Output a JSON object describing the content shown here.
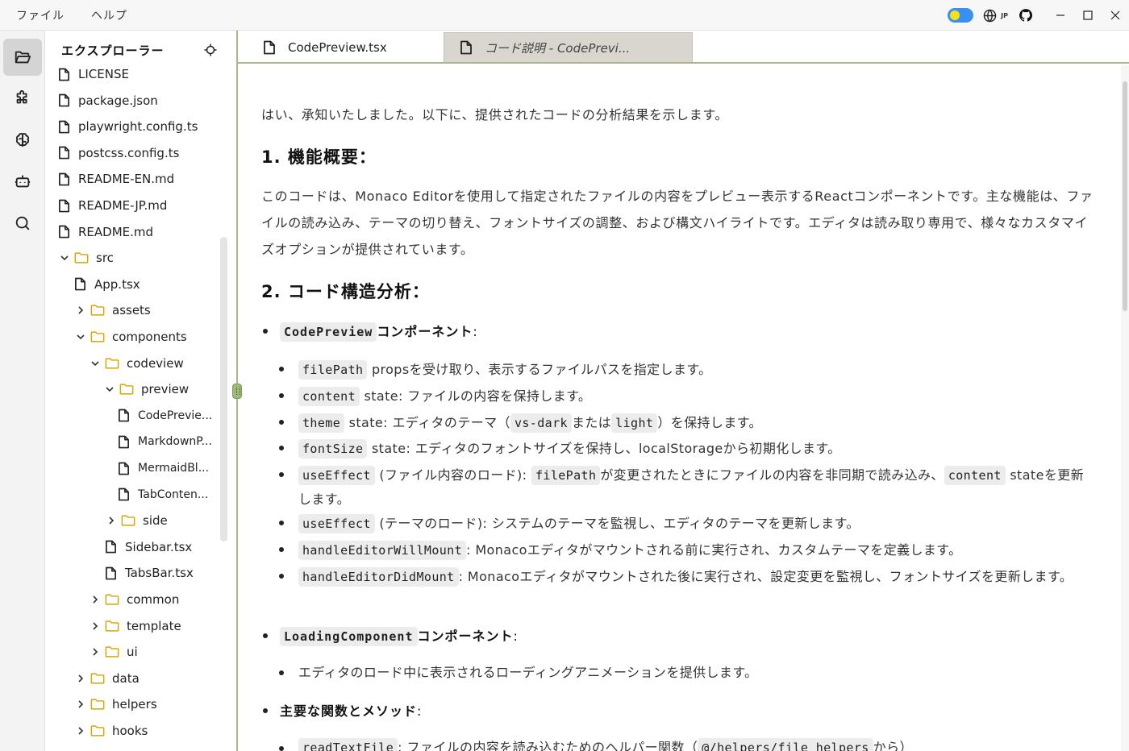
{
  "menu": {
    "file": "ファイル",
    "help": "ヘルプ"
  },
  "titlebar": {
    "lang_label": "JP"
  },
  "explorer": {
    "title": "エクスプローラー",
    "items": [
      {
        "label": "LICENSE",
        "kind": "file"
      },
      {
        "label": "package.json",
        "kind": "file"
      },
      {
        "label": "playwright.config.ts",
        "kind": "file"
      },
      {
        "label": "postcss.config.ts",
        "kind": "file"
      },
      {
        "label": "README-EN.md",
        "kind": "file"
      },
      {
        "label": "README-JP.md",
        "kind": "file"
      },
      {
        "label": "README.md",
        "kind": "file"
      },
      {
        "label": "src",
        "kind": "folder-open"
      },
      {
        "label": "App.tsx",
        "kind": "file"
      },
      {
        "label": "assets",
        "kind": "folder"
      },
      {
        "label": "components",
        "kind": "folder-open"
      },
      {
        "label": "codeview",
        "kind": "folder-open"
      },
      {
        "label": "preview",
        "kind": "folder-open"
      },
      {
        "label": "CodePrevie...",
        "kind": "file"
      },
      {
        "label": "MarkdownP...",
        "kind": "file"
      },
      {
        "label": "MermaidBl...",
        "kind": "file"
      },
      {
        "label": "TabConten...",
        "kind": "file"
      },
      {
        "label": "side",
        "kind": "folder"
      },
      {
        "label": "Sidebar.tsx",
        "kind": "file"
      },
      {
        "label": "TabsBar.tsx",
        "kind": "file"
      },
      {
        "label": "common",
        "kind": "folder"
      },
      {
        "label": "template",
        "kind": "folder"
      },
      {
        "label": "ui",
        "kind": "folder"
      },
      {
        "label": "data",
        "kind": "folder"
      },
      {
        "label": "helpers",
        "kind": "folder"
      },
      {
        "label": "hooks",
        "kind": "folder"
      }
    ]
  },
  "tabs": [
    {
      "label": "CodePreview.tsx"
    },
    {
      "label": "コード説明 - CodePrevi..."
    }
  ],
  "doc": {
    "intro": "はい、承知いたしました。以下に、提供されたコードの分析結果を示します。",
    "h1": "1. 機能概要：",
    "p1": "このコードは、Monaco Editorを使用して指定されたファイルの内容をプレビュー表示するReactコンポーネントです。主な機能は、ファイルの読み込み、テーマの切り替え、フォントサイズの調整、および構文ハイライトです。エディタは読み取り専用で、様々なカスタマイズオプションが提供されています。",
    "h2": "2. コード構造分析：",
    "b1": {
      "code": "CodePreview",
      "text": "コンポーネント",
      "colon": ":"
    },
    "sub1": {
      "filepath": {
        "code": "filePath",
        "text": " propsを受け取り、表示するファイルパスを指定します。"
      },
      "content": {
        "code": "content",
        "text": " state: ファイルの内容を保持します。"
      },
      "theme": {
        "code": "theme",
        "text1": " state: エディタのテーマ（",
        "code2": "vs-dark",
        "text2": "または",
        "code3": "light",
        "text3": "）を保持します。"
      },
      "fontsize": {
        "code": "fontSize",
        "text": " state: エディタのフォントサイズを保持し、localStorageから初期化します。"
      },
      "effect1": {
        "code": "useEffect",
        "text1": " (ファイル内容のロード): ",
        "code2": "filePath",
        "text2": "が変更されたときにファイルの内容を非同期で読み込み、",
        "code3": "content",
        "text3": " stateを更新します。"
      },
      "effect2": {
        "code": "useEffect",
        "text": " (テーマのロード): システムのテーマを監視し、エディタのテーマを更新します。"
      },
      "willmount": {
        "code": "handleEditorWillMount",
        "text": ": Monacoエディタがマウントされる前に実行され、カスタムテーマを定義します。"
      },
      "didmount": {
        "code": "handleEditorDidMount",
        "text": ": Monacoエディタがマウントされた後に実行され、設定変更を監視し、フォントサイズを更新します。"
      }
    },
    "b2": {
      "code": "LoadingComponent",
      "text": "コンポーネント",
      "colon": ":"
    },
    "sub2": {
      "text": "エディタのロード中に表示されるローディングアニメーションを提供します。"
    },
    "b3": {
      "text": "主要な関数とメソッド",
      "colon": ":"
    },
    "sub3": {
      "code": "readTextFile",
      "text1": ": ファイルの内容を読み込むためのヘルパー関数（",
      "code2": "@/helpers/file_helpers",
      "text2": "から）"
    }
  }
}
